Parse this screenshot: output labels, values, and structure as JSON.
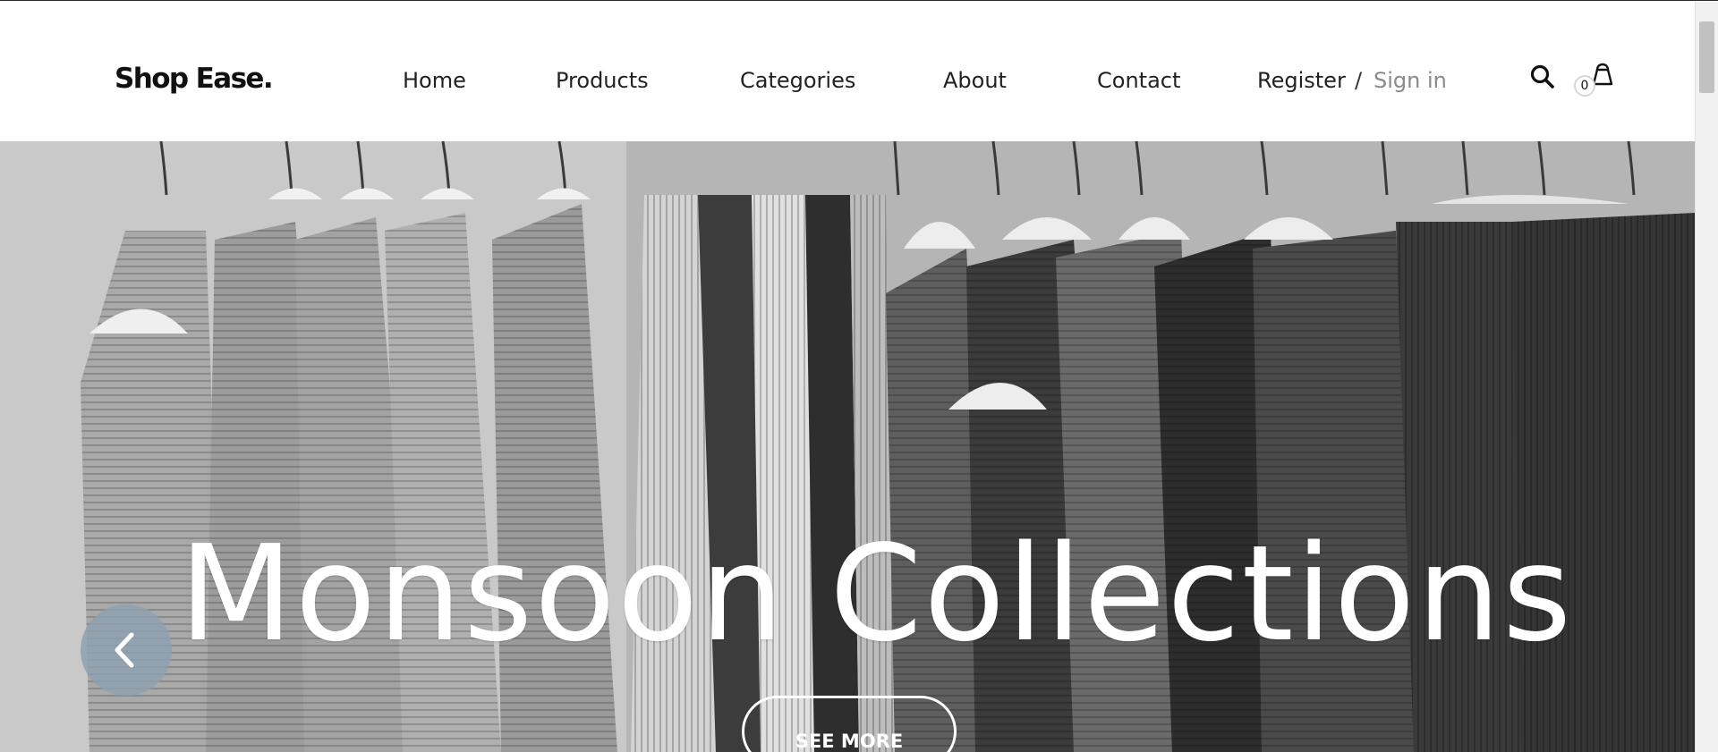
{
  "brand": {
    "logo_text": "Shop Ease."
  },
  "nav": {
    "items": [
      {
        "label": "Home"
      },
      {
        "label": "Products"
      },
      {
        "label": "Categories"
      },
      {
        "label": "About"
      },
      {
        "label": "Contact"
      }
    ],
    "register_label": "Register",
    "separator": "/",
    "signin_label": "Sign in",
    "search_icon": "search-icon",
    "cart_icon": "shopping-bag-icon",
    "cart_count": "0"
  },
  "hero": {
    "title": "Monsoon Collections",
    "cta_label": "SEE MORE",
    "prev_icon": "chevron-left-icon"
  },
  "colors": {
    "text_primary": "#222222",
    "signin_muted": "#8a8a8a",
    "prev_button": "#8ca0af",
    "hero_text": "#ffffff"
  }
}
